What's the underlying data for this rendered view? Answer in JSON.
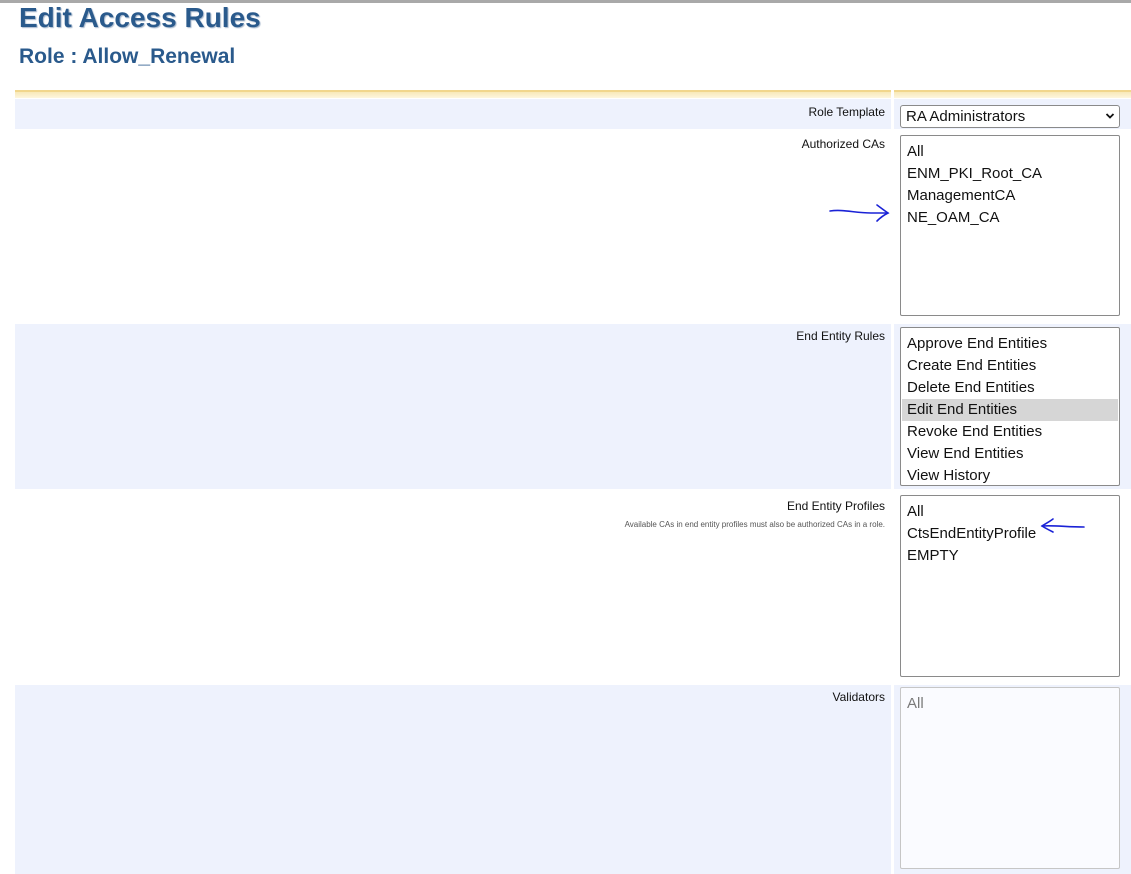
{
  "page": {
    "title": "Edit Access Rules",
    "role_line": "Role : Allow_Renewal"
  },
  "colors": {
    "title": "#2a5a8c",
    "row_shade": "#eef2fd",
    "header_bar": "#f1d68c",
    "annotation": "#1a22d6",
    "selected_option": "#d6d6d6"
  },
  "rows": {
    "role_template": {
      "label": "Role Template",
      "selected_value": "RA Administrators"
    },
    "authorized_cas": {
      "label": "Authorized CAs",
      "options": [
        "All",
        "ENM_PKI_Root_CA",
        "ManagementCA",
        "NE_OAM_CA"
      ]
    },
    "end_entity_rules": {
      "label": "End Entity Rules",
      "options": [
        "Approve End Entities",
        "Create End Entities",
        "Delete End Entities",
        "Edit End Entities",
        "Revoke End Entities",
        "View End Entities",
        "View History"
      ],
      "selected": "Edit End Entities"
    },
    "end_entity_profiles": {
      "label": "End Entity Profiles",
      "help": "Available CAs in end entity profiles must also be authorized CAs in a role.",
      "options": [
        "All",
        "CtsEndEntityProfile",
        "EMPTY"
      ]
    },
    "validators": {
      "label": "Validators",
      "options": [
        "All"
      ],
      "disabled": true
    }
  },
  "annotations": {
    "arrow_1_icon": "hand-drawn-arrow-right-icon",
    "arrow_2_icon": "hand-drawn-arrow-left-icon"
  }
}
